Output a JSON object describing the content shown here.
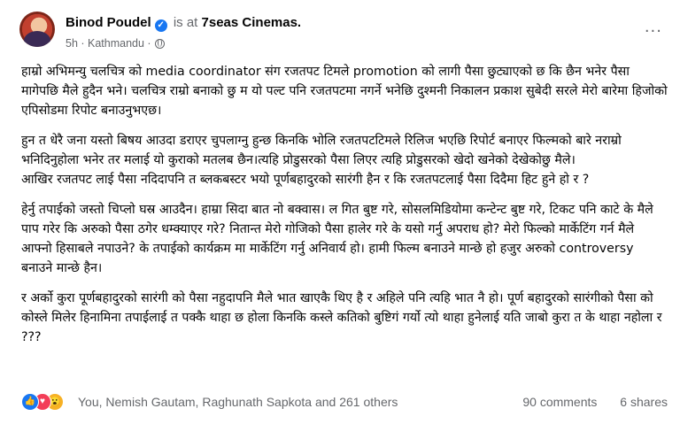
{
  "post": {
    "author": "Binod Poudel",
    "is_at": "is at",
    "place": "7seas Cinemas.",
    "time": "5h · Kathmandu ·",
    "more_label": "···",
    "verified_mark": "✓",
    "paragraphs": [
      "हाम्रो अभिमन्यु चलचित्र को media coordinator संग रजतपट टिमले  promotion को लागी पैसा छुट्याएको छ कि छैन भनेर पैसा मागेपछि मैले हुदैन भने। चलचित्र राम्रो बनाको छु म यो पल्ट पनि रजतपटमा नगर्ने भनेछि दुश्मनी निकालन प्रकाश सुबेदी सरले मेरो बारेमा हिजोको एपिसोडमा रिपोट बनाउनुभएछ।",
      "हुन त धेरै जना यस्तो बिषय आउदा डराएर चुपलाग्नु हुन्छ किनकि भोलि रजतपटटिमले रिलिज भएछि रिपोर्ट बनाएर फिल्मको बारे नराम्रो भनिदिनुहोला भनेर तर मलाई यो कुराको मतलब छैन।त्यहि प्रोडुसरको पैसा लिएर त्यहि प्रोडुसरको खेदो खनेको देखेकोछु मैले।\nआखिर रजतपट लाई पैसा नदिदापनि त ब्लकबस्टर भयो पूर्णबहादुरको सारंगी हैन र कि रजतपटलाई पैसा दिदैमा हिट हुने हो र ?",
      "हेर्नु तपाईको जस्तो चिप्लो घस्र आउदैन। हाम्रा सिदा बात नो बक्वास। ल गित बुष्ट गरे, सोसलमिडियोमा कन्टेन्ट बुष्ट गरे, टिकट पनि काटे के मैले पाप गरेर कि अरुको पैसा ठगेर धम्क्याएर गरे?  नितान्त मेरो गोजिको पैसा हालेर गरे के यसो गर्नु अपराध हो? मेरो फिल्को मार्केटिंग गर्न मैले आफ्नो हिसाबले नपाउने? के तपाईको कार्यक्रम मा मार्केटिंग गर्नु अनिवार्य हो। हामी फिल्म बनाउने मान्छे हो हजुर अरुको controversy बनाउने मान्छे हैन।",
      "र अर्को कुरा पूर्णबहादुरको सारंगी को पैसा नहुदापनि मैले भात खाएकै थिए है र अहिले पनि त्यहि भात नै हो। पूर्ण बहादुरको सारंगीको पैसा को कोस्ले मिलेर हिनामिना तपाईलाई त पक्कै थाहा छ होला किनकि कस्ले कतिको बुष्टिगं गर्यो त्यो थाहा हुनेलाई यति जाबो कुरा त के थाहा नहोला र ???"
    ]
  },
  "footer": {
    "reactions": [
      {
        "name": "like",
        "glyph": "👍"
      },
      {
        "name": "love",
        "glyph": "♥"
      },
      {
        "name": "wow",
        "glyph": "😮"
      }
    ],
    "reactors": "You, Nemish Gautam, Raghunath Sapkota and 261 others",
    "comments": "90 comments",
    "shares": "6 shares"
  },
  "colors": {
    "accent": "#1877f2",
    "secondary_text": "#65676b",
    "love": "#f33e58",
    "wow": "#f7b125"
  }
}
